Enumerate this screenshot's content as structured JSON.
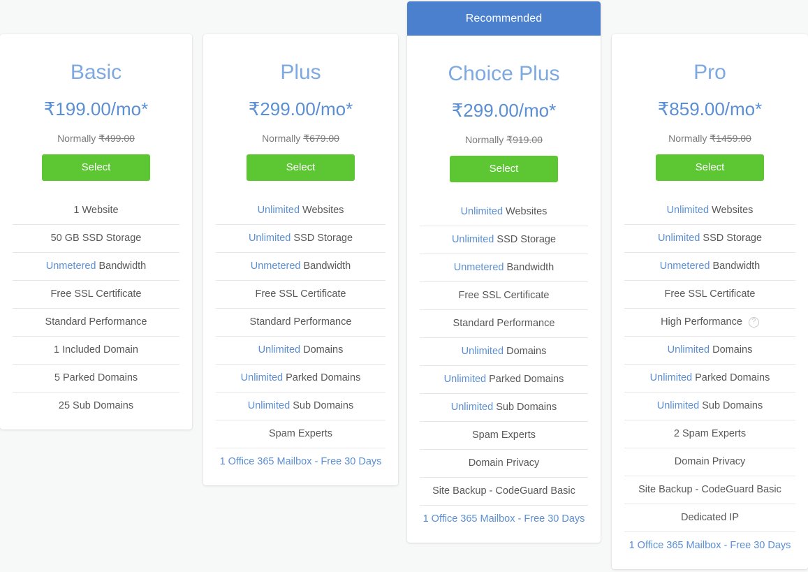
{
  "colors": {
    "page_bg": "#f7f8f8",
    "accent_blue": "#5b8fd4",
    "title_blue": "#7da9e0",
    "ribbon_blue": "#4a80ce",
    "select_green": "#5cc633",
    "body_gray": "#585858"
  },
  "plans": [
    {
      "id": "basic",
      "name": "Basic",
      "price": "₹199.00/mo*",
      "normally_label": "Normally",
      "normally_price": "₹499.00",
      "select_label": "Select",
      "ribbon": null,
      "features": [
        {
          "highlight": "",
          "text": "1 Website",
          "style": "plain",
          "help": false
        },
        {
          "highlight": "",
          "text": "50 GB SSD Storage",
          "style": "plain",
          "help": false
        },
        {
          "highlight": "Unmetered",
          "text": "Bandwidth",
          "style": "plain",
          "help": false
        },
        {
          "highlight": "",
          "text": "Free SSL Certificate",
          "style": "plain",
          "help": false
        },
        {
          "highlight": "",
          "text": "Standard Performance",
          "style": "plain",
          "help": false
        },
        {
          "highlight": "",
          "text": "1 Included Domain",
          "style": "plain",
          "help": false
        },
        {
          "highlight": "",
          "text": "5 Parked Domains",
          "style": "plain",
          "help": false
        },
        {
          "highlight": "",
          "text": "25 Sub Domains",
          "style": "plain",
          "help": false
        }
      ]
    },
    {
      "id": "plus",
      "name": "Plus",
      "price": "₹299.00/mo*",
      "normally_label": "Normally",
      "normally_price": "₹679.00",
      "select_label": "Select",
      "ribbon": null,
      "features": [
        {
          "highlight": "Unlimited",
          "text": "Websites",
          "style": "plain",
          "help": false
        },
        {
          "highlight": "Unlimited",
          "text": "SSD Storage",
          "style": "plain",
          "help": false
        },
        {
          "highlight": "Unmetered",
          "text": "Bandwidth",
          "style": "plain",
          "help": false
        },
        {
          "highlight": "",
          "text": "Free SSL Certificate",
          "style": "plain",
          "help": false
        },
        {
          "highlight": "",
          "text": "Standard Performance",
          "style": "plain",
          "help": false
        },
        {
          "highlight": "Unlimited",
          "text": "Domains",
          "style": "plain",
          "help": false
        },
        {
          "highlight": "Unlimited",
          "text": "Parked Domains",
          "style": "plain",
          "help": false
        },
        {
          "highlight": "Unlimited",
          "text": "Sub Domains",
          "style": "plain",
          "help": false
        },
        {
          "highlight": "",
          "text": "Spam Experts",
          "style": "plain",
          "help": false
        },
        {
          "highlight": "",
          "text": "1 Office 365 Mailbox - Free 30 Days",
          "style": "link",
          "help": false
        }
      ]
    },
    {
      "id": "choice-plus",
      "name": "Choice Plus",
      "price": "₹299.00/mo*",
      "normally_label": "Normally",
      "normally_price": "₹919.00",
      "select_label": "Select",
      "ribbon": "Recommended",
      "features": [
        {
          "highlight": "Unlimited",
          "text": "Websites",
          "style": "plain",
          "help": false
        },
        {
          "highlight": "Unlimited",
          "text": "SSD Storage",
          "style": "plain",
          "help": false
        },
        {
          "highlight": "Unmetered",
          "text": "Bandwidth",
          "style": "plain",
          "help": false
        },
        {
          "highlight": "",
          "text": "Free SSL Certificate",
          "style": "plain",
          "help": false
        },
        {
          "highlight": "",
          "text": "Standard Performance",
          "style": "plain",
          "help": false
        },
        {
          "highlight": "Unlimited",
          "text": "Domains",
          "style": "plain",
          "help": false
        },
        {
          "highlight": "Unlimited",
          "text": "Parked Domains",
          "style": "plain",
          "help": false
        },
        {
          "highlight": "Unlimited",
          "text": "Sub Domains",
          "style": "plain",
          "help": false
        },
        {
          "highlight": "",
          "text": "Spam Experts",
          "style": "plain",
          "help": false
        },
        {
          "highlight": "",
          "text": "Domain Privacy",
          "style": "plain",
          "help": false
        },
        {
          "highlight": "",
          "text": "Site Backup - CodeGuard Basic",
          "style": "plain",
          "help": false
        },
        {
          "highlight": "",
          "text": "1 Office 365 Mailbox - Free 30 Days",
          "style": "link",
          "help": false
        }
      ]
    },
    {
      "id": "pro",
      "name": "Pro",
      "price": "₹859.00/mo*",
      "normally_label": "Normally",
      "normally_price": "₹1459.00",
      "select_label": "Select",
      "ribbon": null,
      "features": [
        {
          "highlight": "Unlimited",
          "text": "Websites",
          "style": "plain",
          "help": false
        },
        {
          "highlight": "Unlimited",
          "text": "SSD Storage",
          "style": "plain",
          "help": false
        },
        {
          "highlight": "Unmetered",
          "text": "Bandwidth",
          "style": "plain",
          "help": false
        },
        {
          "highlight": "",
          "text": "Free SSL Certificate",
          "style": "plain",
          "help": false
        },
        {
          "highlight": "",
          "text": "High Performance",
          "style": "plain",
          "help": true
        },
        {
          "highlight": "Unlimited",
          "text": "Domains",
          "style": "plain",
          "help": false
        },
        {
          "highlight": "Unlimited",
          "text": "Parked Domains",
          "style": "plain",
          "help": false
        },
        {
          "highlight": "Unlimited",
          "text": "Sub Domains",
          "style": "plain",
          "help": false
        },
        {
          "highlight": "",
          "text": "2 Spam Experts",
          "style": "plain",
          "help": false
        },
        {
          "highlight": "",
          "text": "Domain Privacy",
          "style": "plain",
          "help": false
        },
        {
          "highlight": "",
          "text": "Site Backup - CodeGuard Basic",
          "style": "plain",
          "help": false
        },
        {
          "highlight": "",
          "text": "Dedicated IP",
          "style": "plain",
          "help": false
        },
        {
          "highlight": "",
          "text": "1 Office 365 Mailbox - Free 30 Days",
          "style": "link",
          "help": false
        }
      ]
    }
  ],
  "icons": {
    "help": "?"
  }
}
